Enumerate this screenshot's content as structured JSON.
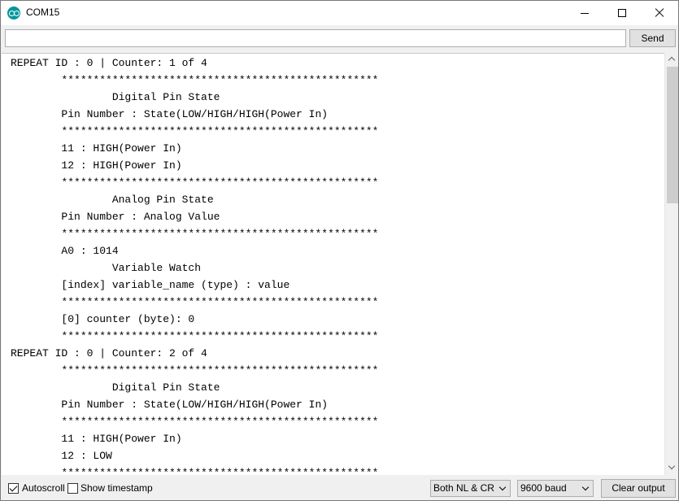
{
  "window": {
    "title": "COM15",
    "app_icon": "arduino-icon"
  },
  "send_bar": {
    "input_value": "",
    "send_label": "Send"
  },
  "output": {
    "lines": [
      "REPEAT ID : 0 | Counter: 1 of 4",
      "        **************************************************",
      "                Digital Pin State",
      "        Pin Number : State(LOW/HIGH/HIGH(Power In)",
      "        **************************************************",
      "        11 : HIGH(Power In)",
      "        12 : HIGH(Power In)",
      "        **************************************************",
      "                Analog Pin State",
      "        Pin Number : Analog Value",
      "        **************************************************",
      "        A0 : 1014",
      "                Variable Watch",
      "        [index] variable_name (type) : value",
      "        **************************************************",
      "        [0] counter (byte): 0",
      "        **************************************************",
      "REPEAT ID : 0 | Counter: 2 of 4",
      "        **************************************************",
      "                Digital Pin State",
      "        Pin Number : State(LOW/HIGH/HIGH(Power In)",
      "        **************************************************",
      "        11 : HIGH(Power In)",
      "        12 : LOW",
      "        **************************************************"
    ]
  },
  "bottom_bar": {
    "autoscroll_label": "Autoscroll",
    "autoscroll_checked": true,
    "timestamp_label": "Show timestamp",
    "timestamp_checked": false,
    "line_ending": "Both NL & CR",
    "baud_rate": "9600 baud",
    "clear_label": "Clear output"
  }
}
